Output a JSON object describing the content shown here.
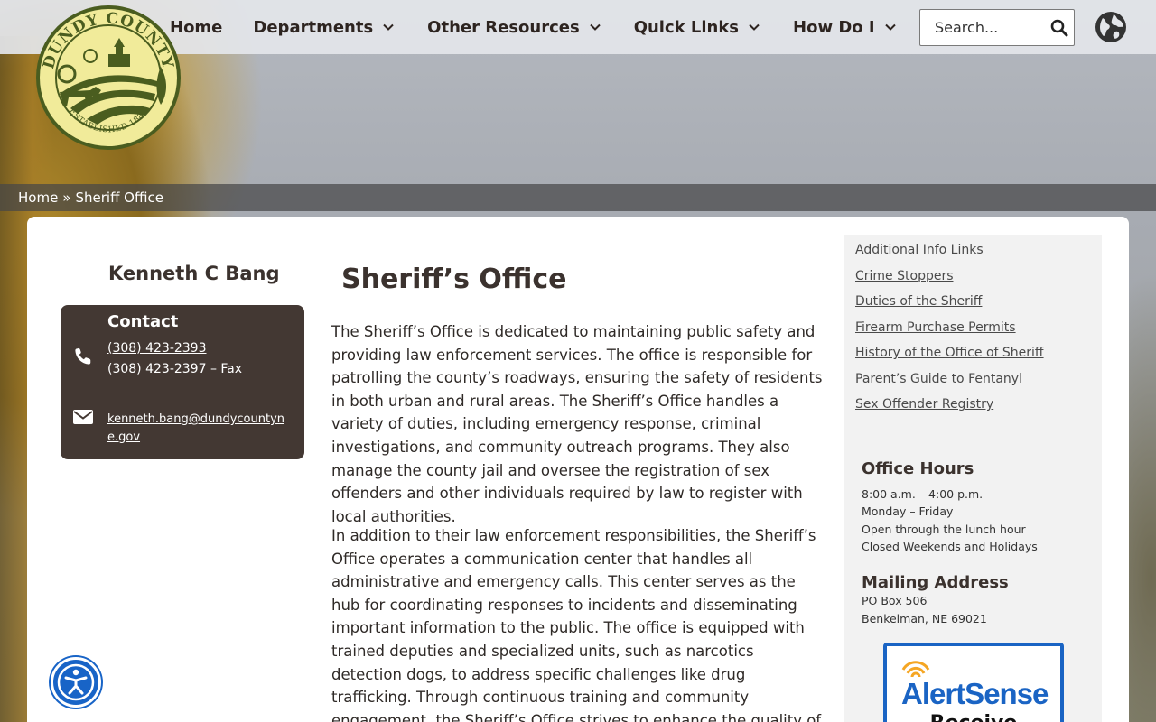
{
  "header": {
    "nav": [
      {
        "label": "Home",
        "has_dropdown": false
      },
      {
        "label": "Departments",
        "has_dropdown": true
      },
      {
        "label": "Other Resources",
        "has_dropdown": true
      },
      {
        "label": "Quick Links",
        "has_dropdown": true
      },
      {
        "label": "How Do I",
        "has_dropdown": true
      }
    ],
    "search": {
      "placeholder": "Search..."
    },
    "icons": {
      "search": "search-icon",
      "globe": "globe-icon",
      "chevron": "chevron-down-icon"
    }
  },
  "logo": {
    "top_text": "DUNDY COUNTY",
    "bottom_text": "ESTABLISHED 1884",
    "icon": "county-seal"
  },
  "breadcrumb": {
    "home": "Home",
    "separator": "»",
    "current": "Sheriff Office"
  },
  "contact": {
    "name": "Kenneth C Bang",
    "title": "Contact",
    "phone": "(308) 423-2393",
    "fax": "(308) 423-2397 – Fax",
    "email": "kenneth.bang@dundycountyne.gov",
    "icons": {
      "phone": "phone-icon",
      "email": "envelope-icon"
    }
  },
  "main": {
    "title": "Sheriff’s Office",
    "paragraphs": [
      "The Sheriff’s Office is dedicated to maintaining public safety and providing law enforcement services. The office is responsible for patrolling the county’s roadways, ensuring the safety of residents in both urban and rural areas. The Sheriff’s Office handles a variety of duties, including emergency response, criminal investigations, and community outreach programs. They also manage the county jail and oversee the registration of sex offenders and other individuals required by law to register with local authorities.",
      "In addition to their law enforcement responsibilities, the Sheriff’s Office operates a communication center that handles all administrative and emergency calls. This center serves as the hub for coordinating responses to incidents and disseminating important information to the public. The office is equipped with trained deputies and specialized units, such as narcotics detection dogs, to address specific challenges like drug trafficking. Through continuous training and community engagement, the Sheriff’s Office strives to enhance the quality of life for all residents by ensuring a safe and secure environment."
    ]
  },
  "sidebar": {
    "links": [
      "Additional Info Links",
      "Crime Stoppers",
      "Duties of the Sheriff",
      "Firearm Purchase Permits",
      "History of the Office of Sheriff",
      "Parent’s Guide to Fentanyl",
      "Sex Offender Registry"
    ],
    "office_hours": {
      "heading": "Office Hours",
      "lines": [
        "8:00 a.m. – 4:00 p.m.",
        "Monday – Friday",
        "Open through the lunch hour",
        "Closed Weekends and Holidays"
      ]
    },
    "mailing": {
      "heading": "Mailing Address",
      "lines": [
        "PO Box 506",
        "Benkelman, NE 69021"
      ]
    },
    "alert": {
      "brand": "AlertSense",
      "cta": "Receive"
    }
  },
  "accessibility": {
    "icon": "accessibility-icon"
  },
  "colors": {
    "brand_dark": "#433833",
    "text_heading": "#3b322e",
    "breadcrumb_bg": "#464648",
    "alert_blue": "#1a64c4",
    "a11y_blue": "#1864c7",
    "seal_green": "#4a5d1f",
    "seal_yellow": "#f1eb9a"
  }
}
